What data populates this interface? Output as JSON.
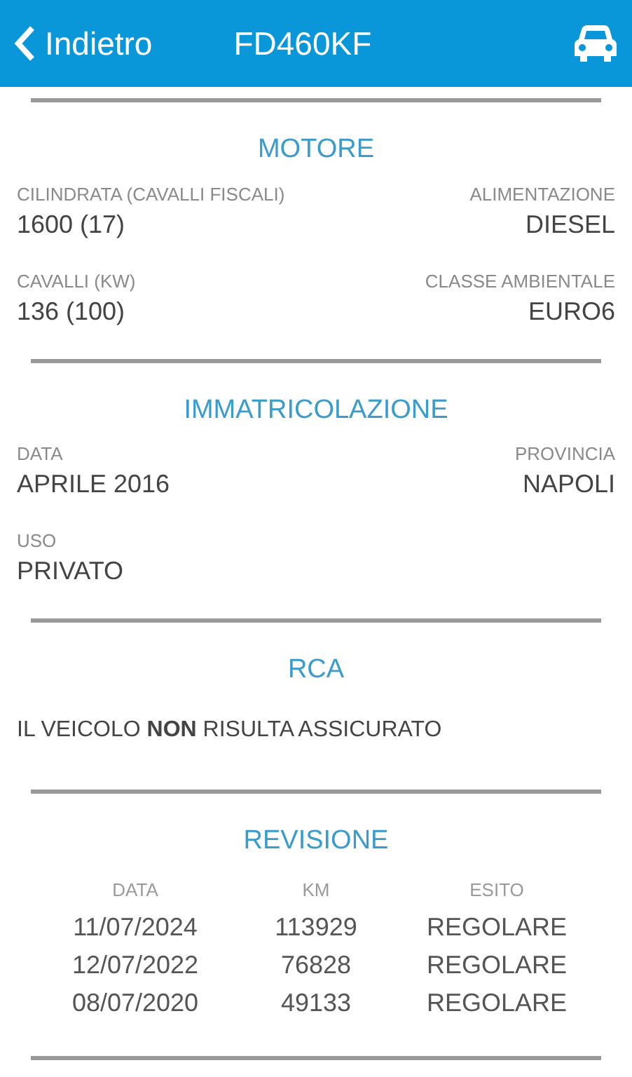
{
  "header": {
    "back": "Indietro",
    "title": "FD460KF"
  },
  "sections": [
    {
      "kind": "fields",
      "title": "MOTORE",
      "rows": [
        [
          {
            "label": "CILINDRATA (CAVALLI FISCALI)",
            "value": "1600 (17)"
          },
          {
            "label": "ALIMENTAZIONE",
            "value": "DIESEL"
          }
        ],
        [
          {
            "label": "CAVALLI (KW)",
            "value": "136 (100)"
          },
          {
            "label": "CLASSE AMBIENTALE",
            "value": "EURO6"
          }
        ]
      ]
    },
    {
      "kind": "fields",
      "title": "IMMATRICOLAZIONE",
      "rows": [
        [
          {
            "label": "DATA",
            "value": "APRILE 2016"
          },
          {
            "label": "PROVINCIA",
            "value": "NAPOLI"
          }
        ],
        [
          {
            "label": "USO",
            "value": "PRIVATO"
          }
        ]
      ]
    },
    {
      "kind": "text",
      "title": "RCA",
      "text": "IL VEICOLO **NON** RISULTA ASSICURATO"
    },
    {
      "kind": "table",
      "title": "REVISIONE",
      "columns": [
        "DATA",
        "KM",
        "ESITO"
      ],
      "rows": [
        [
          "11/07/2024",
          "113929",
          "REGOLARE"
        ],
        [
          "12/07/2022",
          "76828",
          "REGOLARE"
        ],
        [
          "08/07/2020",
          "49133",
          "REGOLARE"
        ]
      ]
    }
  ]
}
